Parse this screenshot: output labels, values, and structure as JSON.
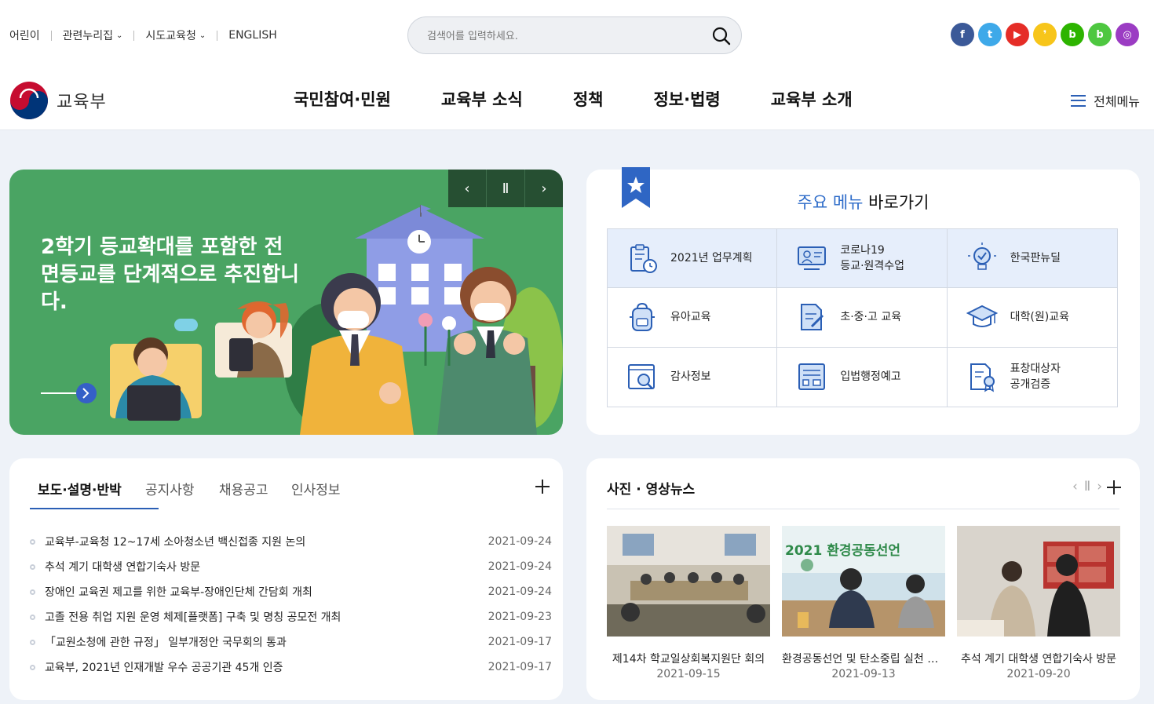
{
  "header": {
    "util_links": [
      {
        "label": "어린이",
        "has_menu": false
      },
      {
        "label": "관련누리집",
        "has_menu": true
      },
      {
        "label": "시도교육청",
        "has_menu": true
      },
      {
        "label": "ENGLISH",
        "has_menu": false
      }
    ],
    "search": {
      "placeholder": "검색어를 입력하세요.",
      "value": ""
    },
    "social": [
      {
        "name": "facebook",
        "glyph": "f",
        "color": "#3b5998"
      },
      {
        "name": "twitter",
        "glyph": "t",
        "color": "#3ea9e9"
      },
      {
        "name": "youtube",
        "glyph": "▶",
        "color": "#e52d27"
      },
      {
        "name": "kakao",
        "glyph": "❜",
        "color": "#f7c51a"
      },
      {
        "name": "naver-blog",
        "glyph": "b",
        "color": "#2db400"
      },
      {
        "name": "band",
        "glyph": "b",
        "color": "#4ec740"
      },
      {
        "name": "instagram",
        "glyph": "◎",
        "color": "#9b3cc3"
      }
    ],
    "logo_text": "교육부",
    "gnb": [
      "국민참여·민원",
      "교육부 소식",
      "정책",
      "정보·법령",
      "교육부 소개"
    ],
    "all_menu": "전체메뉴"
  },
  "banner": {
    "slogan": "2학기 등교확대를 포함한 전면등교를 단계적으로 추진합니다.",
    "controls": {
      "prev": "‹",
      "pause": "Ⅱ",
      "next": "›"
    }
  },
  "quick": {
    "title_highlight": "주요 메뉴",
    "title_rest": " 바로가기",
    "items": [
      {
        "label": "2021년 업무계획",
        "icon": "clipboard-clock-icon"
      },
      {
        "label": "코로나19\n등교·원격수업",
        "icon": "online-class-icon"
      },
      {
        "label": "한국판뉴딜",
        "icon": "lightbulb-icon"
      },
      {
        "label": "유아교육",
        "icon": "backpack-icon"
      },
      {
        "label": "초·중·고 교육",
        "icon": "document-pen-icon"
      },
      {
        "label": "대학(원)교육",
        "icon": "graduation-cap-icon"
      },
      {
        "label": "감사정보",
        "icon": "magnifier-window-icon"
      },
      {
        "label": "입법행정예고",
        "icon": "document-list-icon"
      },
      {
        "label": "표창대상자\n공개검증",
        "icon": "award-document-icon"
      }
    ]
  },
  "news": {
    "tabs": [
      "보도·설명·반박",
      "공지사항",
      "채용공고",
      "인사정보"
    ],
    "active_tab": 0,
    "items": [
      {
        "title": "교육부-교육청 12~17세 소아청소년 백신접종 지원 논의",
        "date": "2021-09-24"
      },
      {
        "title": "추석 계기 대학생 연합기숙사 방문",
        "date": "2021-09-24"
      },
      {
        "title": "장애인 교육권 제고를 위한 교육부-장애인단체 간담회 개최",
        "date": "2021-09-24"
      },
      {
        "title": "고졸 전용 취업 지원 운영 체제[플랫폼] 구축 및 명칭 공모전 개최",
        "date": "2021-09-23"
      },
      {
        "title": "「교원소청에 관한 규정」 일부개정안 국무회의 통과",
        "date": "2021-09-17"
      },
      {
        "title": "교육부, 2021년 인재개발 우수 공공기관 45개 인증",
        "date": "2021-09-17"
      }
    ]
  },
  "photo": {
    "title": "사진 · 영상뉴스",
    "controls": {
      "prev": "‹",
      "pause": "Ⅱ",
      "next": "›"
    },
    "cards": [
      {
        "caption": "제14차 학교일상회복지원단 회의",
        "date": "2021-09-15"
      },
      {
        "caption": "환경공동선언 및 탄소중립 실천 다짐",
        "date": "2021-09-13",
        "image_text": "2021 환경공동선언"
      },
      {
        "caption": "추석 계기 대학생 연합기숙사 방문",
        "date": "2021-09-20"
      }
    ]
  }
}
